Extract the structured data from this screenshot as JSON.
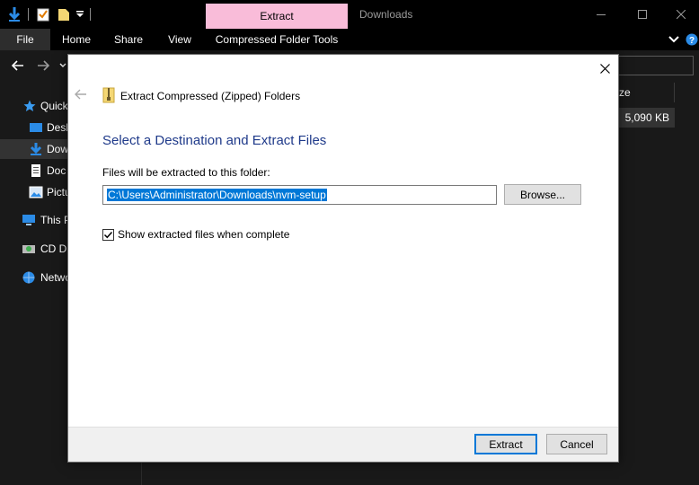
{
  "titlebar": {
    "context_tab": "Extract",
    "window_title": "Downloads"
  },
  "ribbon": {
    "tabs": [
      {
        "label": "File"
      },
      {
        "label": "Home"
      },
      {
        "label": "Share"
      },
      {
        "label": "View"
      },
      {
        "label": "Compressed Folder Tools"
      }
    ]
  },
  "navpane": {
    "items": [
      {
        "label": "Quick",
        "icon": "star-icon"
      },
      {
        "label": "Desk",
        "icon": "desktop-icon"
      },
      {
        "label": "Dow",
        "icon": "download-arrow-icon"
      },
      {
        "label": "Doc",
        "icon": "documents-icon"
      },
      {
        "label": "Pictu",
        "icon": "pictures-icon"
      },
      {
        "label": "This P",
        "icon": "this-pc-icon"
      },
      {
        "label": "CD Dr",
        "icon": "cd-drive-icon"
      },
      {
        "label": "Netwo",
        "icon": "network-icon"
      }
    ]
  },
  "content": {
    "size_header": "ze",
    "size_value": "5,090 KB"
  },
  "dialog": {
    "title": "Extract Compressed (Zipped) Folders",
    "heading": "Select a Destination and Extract Files",
    "dest_label": "Files will be extracted to this folder:",
    "dest_path": "C:\\Users\\Administrator\\Downloads\\nvm-setup",
    "browse_label": "Browse...",
    "show_files_label": "Show extracted files when complete",
    "show_files_checked": true,
    "extract_label": "Extract",
    "cancel_label": "Cancel"
  },
  "colors": {
    "accent": "#0078d7",
    "context_tab": "#f9bcd9",
    "heading": "#1f3a8a"
  }
}
